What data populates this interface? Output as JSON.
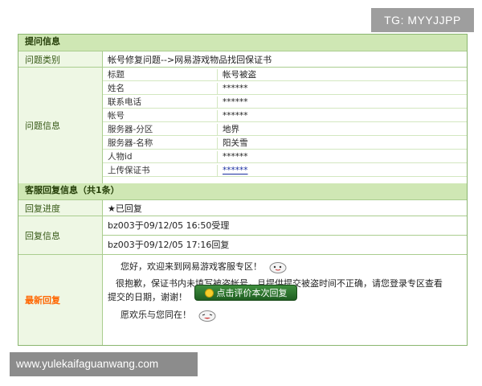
{
  "watermark_top": "TG: MYYJJPP",
  "watermark_bottom": "www.yulekaifaguanwang.com",
  "sections": {
    "question_info": "提问信息",
    "reply_info": "客服回复信息（共1条）"
  },
  "question": {
    "type_label": "问题类别",
    "type_value": "帐号修复问题-->网易游戏物品找回保证书",
    "info_label": "问题信息",
    "fields": [
      {
        "key": "标题",
        "value": "帐号被盗"
      },
      {
        "key": "姓名",
        "value": "******"
      },
      {
        "key": "联系电话",
        "value": "******"
      },
      {
        "key": "帐号",
        "value": "******"
      },
      {
        "key": "服务器-分区",
        "value": "地界"
      },
      {
        "key": "服务器-名称",
        "value": "阳关雪"
      },
      {
        "key": "人物id",
        "value": "******"
      },
      {
        "key": "上传保证书",
        "value": "******"
      }
    ]
  },
  "reply": {
    "progress_label": "回复进度",
    "progress_value": "★已回复",
    "info_label": "回复信息",
    "info_lines": [
      "bz003于09/12/05 16:50受理",
      "bz003于09/12/05 17:16回复"
    ],
    "latest_label": "最新回复",
    "latest_lines": [
      "您好，欢迎来到网易游戏客服专区！",
      "很抱歉，保证书内未填写被盗帐号，且提供提交被盗时间不正确，请您登录专区查看",
      "提交的日期，谢谢！",
      "愿欢乐与您同在！"
    ],
    "rate_button": "点击评价本次回复"
  }
}
